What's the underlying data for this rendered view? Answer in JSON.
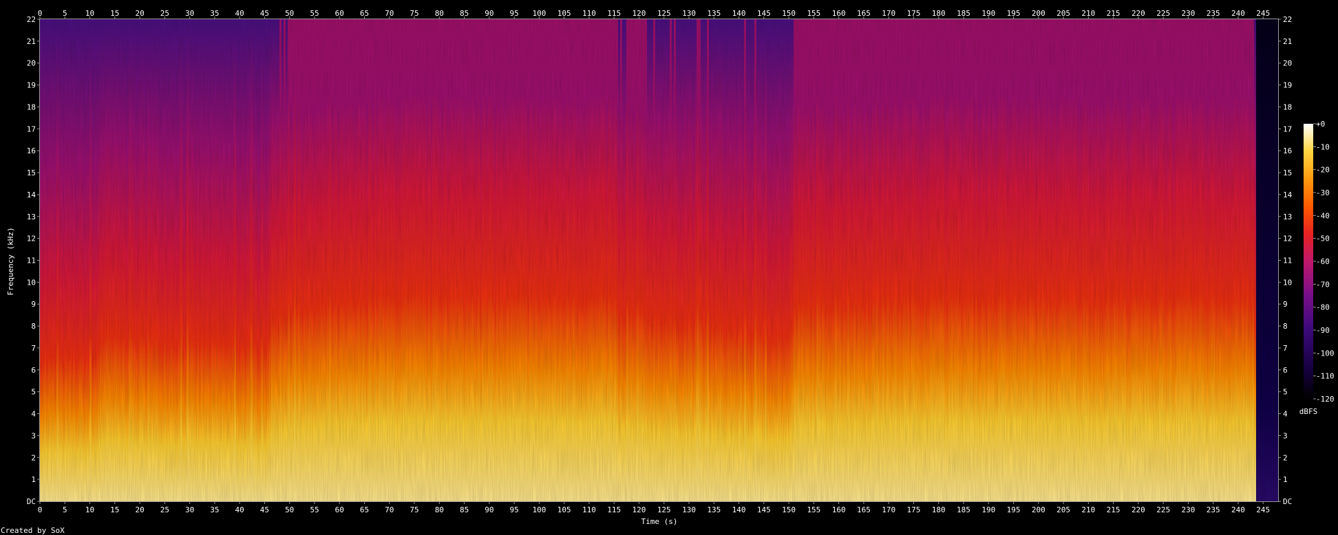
{
  "chart_data": {
    "type": "heatmap",
    "subtype": "spectrogram",
    "xlabel": "Time (s)",
    "ylabel": "Frequency (kHz)",
    "x_ticks": [
      0,
      5,
      10,
      15,
      20,
      25,
      30,
      35,
      40,
      45,
      50,
      55,
      60,
      65,
      70,
      75,
      80,
      85,
      90,
      95,
      100,
      105,
      110,
      115,
      120,
      125,
      130,
      135,
      140,
      145,
      150,
      155,
      160,
      165,
      170,
      175,
      180,
      185,
      190,
      195,
      200,
      205,
      210,
      215,
      220,
      225,
      230,
      235,
      240,
      245
    ],
    "y_ticks": [
      "DC",
      "1",
      "2",
      "3",
      "4",
      "5",
      "6",
      "7",
      "8",
      "9",
      "10",
      "11",
      "12",
      "13",
      "14",
      "15",
      "16",
      "17",
      "18",
      "19",
      "20",
      "21",
      "22"
    ],
    "xlim": [
      0,
      248
    ],
    "ylim": [
      0,
      22
    ],
    "duration_s": 243.5,
    "colorbar": {
      "label": "dBFS",
      "ticks": [
        "+0",
        "-10",
        "-20",
        "-30",
        "-40",
        "-50",
        "-60",
        "-70",
        "-80",
        "-90",
        "-100",
        "-110",
        "-120"
      ],
      "range": [
        -120,
        0
      ],
      "colormap": [
        "#000000",
        "#1a0050",
        "#5a0a86",
        "#9a0f86",
        "#cf1855",
        "#f02a14",
        "#ff6a00",
        "#ffac10",
        "#ffe060",
        "#ffffff"
      ]
    },
    "energy_profile": {
      "description_points_time_s": [
        0,
        11,
        12,
        45,
        46,
        48,
        70,
        115,
        116,
        118,
        150,
        151,
        175,
        243,
        243.5
      ],
      "brightness": [
        0.45,
        0.45,
        0.62,
        0.55,
        0.72,
        0.82,
        0.95,
        0.95,
        0.7,
        0.82,
        0.62,
        0.88,
        0.95,
        0.95,
        0.2
      ]
    },
    "footer": "Created by SoX"
  }
}
